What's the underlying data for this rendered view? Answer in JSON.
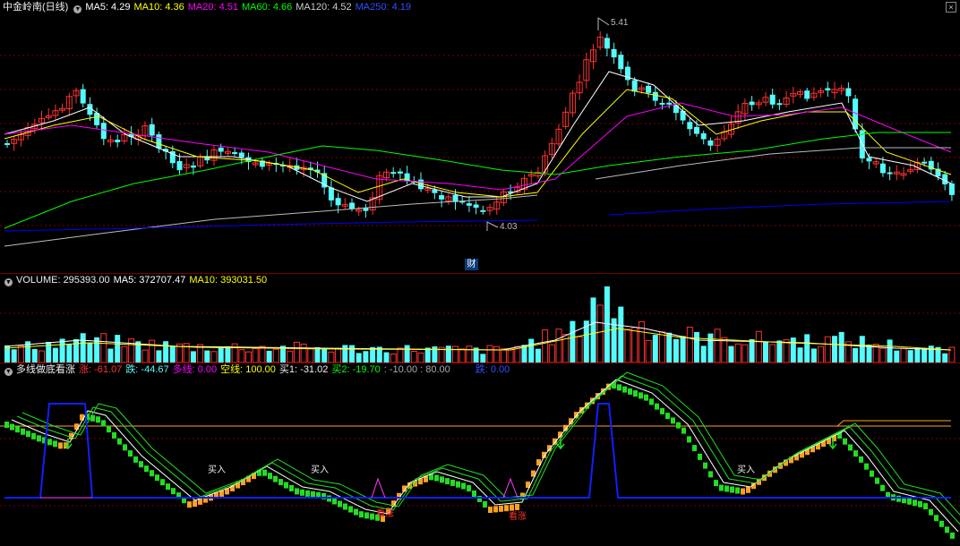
{
  "price_header": {
    "title": "中金岭南(日线)",
    "ma5": "MA5: 4.29",
    "ma10": "MA10: 4.36",
    "ma20": "MA20: 4.51",
    "ma60": "MA60: 4.66",
    "ma120": "MA120: 4.52",
    "ma250": "MA250: 4.19"
  },
  "annotations": {
    "high": "5.41",
    "low": "4.03",
    "fin_badge": "财"
  },
  "vol_header": {
    "volume": "VOLUME: 295393.00",
    "ma5": "MA5: 372707.47",
    "ma10": "MA10: 393031.50"
  },
  "ind_header": {
    "name": "多线做底看涨",
    "zhang": "涨: -61.07",
    "die": "跌: -44.67",
    "duoxian": "多线: 0.00",
    "kongxian": "空线: 100.00",
    "mai1": "买1: -31.02",
    "mai2": "买2: -19.70",
    "levels": ": -10.00 : 80.00",
    "die2": "跌: 0.00"
  },
  "signals": {
    "buy": "买入",
    "up": "看涨"
  },
  "colors": {
    "up": "#ff3232",
    "down": "#54fcfc",
    "ma5": "#ffffff",
    "ma10": "#ffff00",
    "ma20": "#ff00ff",
    "ma60": "#00ff00",
    "ma120": "#bbbbbb",
    "ma250": "#0000ff",
    "grid": "#7a0000",
    "orange": "#ffa020",
    "green": "#22dd22",
    "blue": "#1020ff"
  },
  "icons": {
    "collapse": "collapse-triangle-icon",
    "close": "close-x-icon"
  }
}
